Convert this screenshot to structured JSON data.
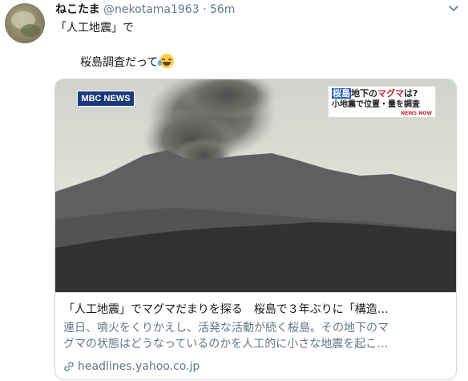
{
  "tweet": {
    "display_name": "ねこたま",
    "handle": "@nekotama1963",
    "separator": "·",
    "time": "56m",
    "text_line1": "「人工地震」で",
    "text_line2": "桜島調査だって"
  },
  "card": {
    "media": {
      "logo_text": "MBC NEWS",
      "overlay_line1_highlight": "桜島",
      "overlay_line1_mid": "地下の",
      "overlay_line1_red": "マグマ",
      "overlay_line1_end": "は?",
      "overlay_line2": "小地震で位置・量を調査",
      "overlay_tag": "NEWS NOW"
    },
    "title": "「人工地震」でマグマだまりを探る　桜島で３年ぶりに「構造…",
    "description_line1": "連日、噴火をくりかえし、活発な活動が続く桜島。その地下のマ",
    "description_line2": "グマの状態はどうなっているのかを人工的に小さな地震を起こ…",
    "domain": "headlines.yahoo.co.jp"
  },
  "colors": {
    "text_primary": "#14171a",
    "text_secondary": "#657786",
    "border": "#ccd6dd"
  }
}
